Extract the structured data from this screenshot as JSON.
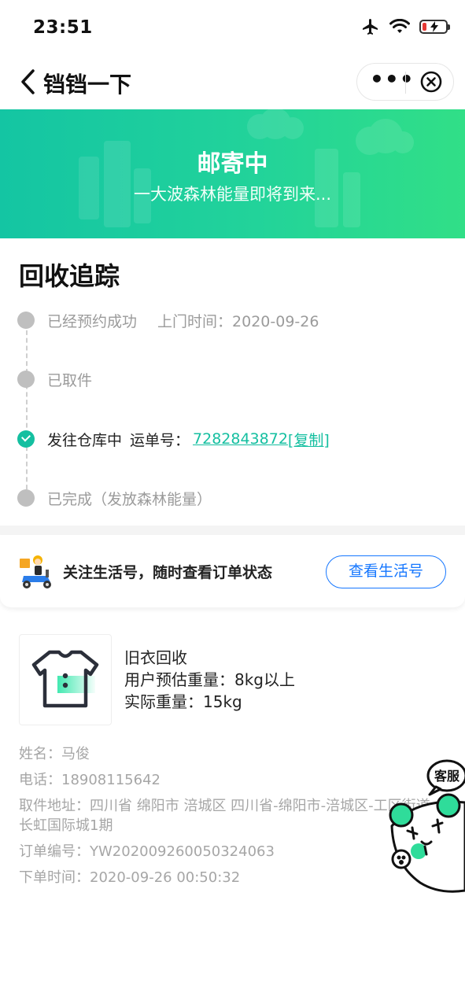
{
  "status_bar": {
    "time": "23:51",
    "icons": [
      "airplane-icon",
      "wifi-icon",
      "battery-charging-icon"
    ],
    "battery_color": "#e53935"
  },
  "nav": {
    "title": "铛铛一下",
    "more_label": "•••"
  },
  "banner": {
    "title": "邮寄中",
    "subtitle": "一大波森林能量即将到来...",
    "colors": [
      "#14c5a3",
      "#31df87"
    ]
  },
  "tracking": {
    "heading": "回收追踪",
    "steps": [
      {
        "label": "已经预约成功",
        "extra": "上门时间：2020-09-26",
        "active": false
      },
      {
        "label": "已取件",
        "active": false
      },
      {
        "label": "发往仓库中",
        "waybill_label": "运单号：",
        "waybill_number": "7282843872",
        "copy_label": "[复制]",
        "active": true
      },
      {
        "label": "已完成（发放森林能量）",
        "active": false
      }
    ],
    "active_color": "#14bfa0"
  },
  "follow": {
    "text": "关注生活号，随时查看订单状态",
    "button": "查看生活号",
    "button_color": "#1677ff"
  },
  "product": {
    "name": "旧衣回收",
    "estimated_weight": "用户预估重量：8kg以上",
    "actual_weight": "实际重量：15kg"
  },
  "order": {
    "name": "姓名：马俊",
    "phone": "电话：18908115642",
    "address": "取件地址：四川省 绵阳市 涪城区 四川省-绵阳市-涪城区-工区街道长虹国际城1期",
    "order_no": "订单编号：YW202009260050324063",
    "order_time": "下单时间：2020-09-26 00:50:32"
  },
  "customer_service": {
    "label": "客服"
  }
}
